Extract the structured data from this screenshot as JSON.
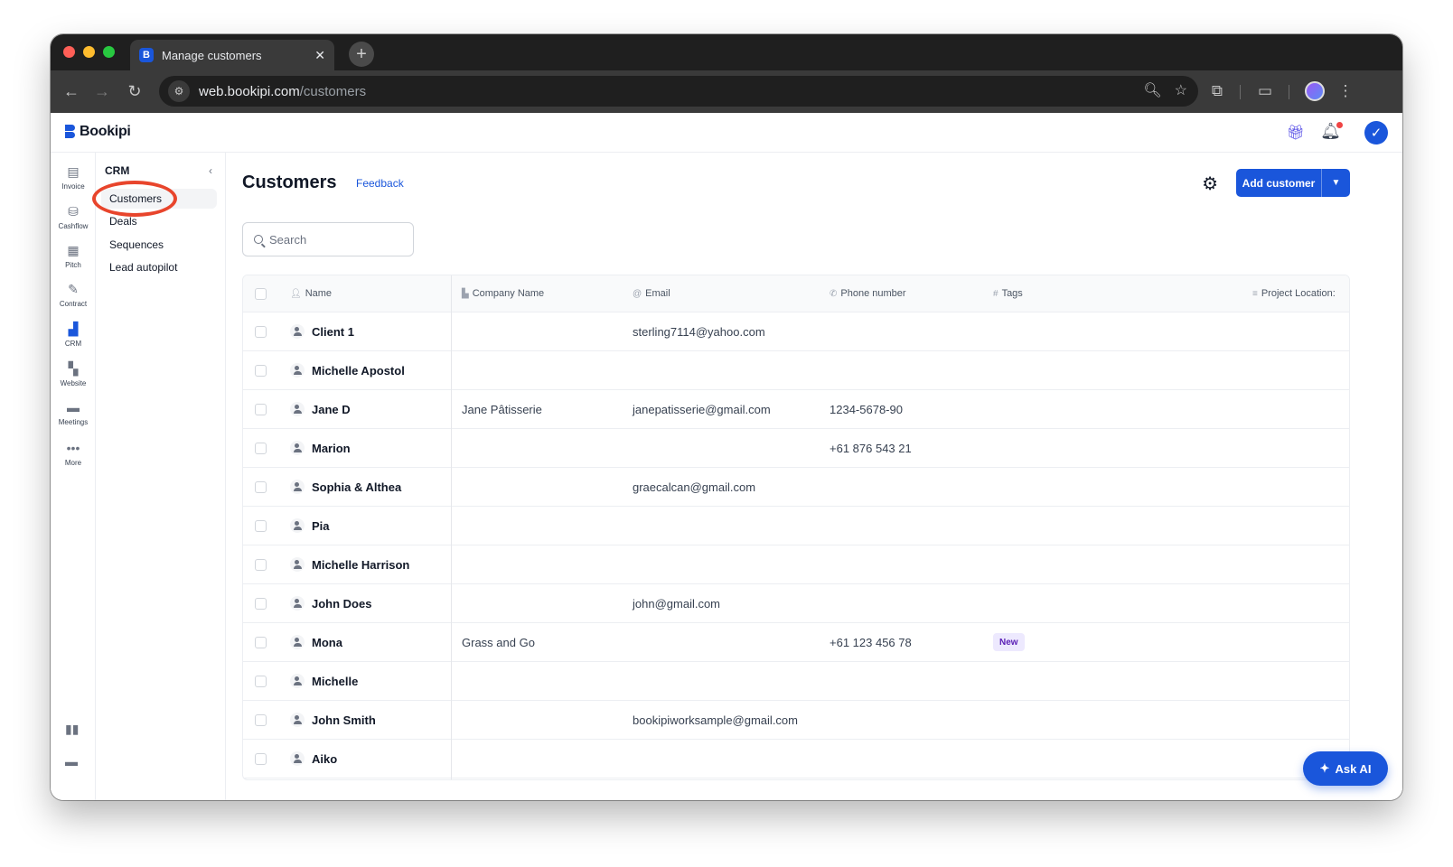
{
  "browser": {
    "tab_title": "Manage customers",
    "favicon_letter": "B",
    "url_host": "web.bookipi.com",
    "url_path": "/customers"
  },
  "app": {
    "brand": "Bookipi",
    "accent_color": "#1a56db"
  },
  "rail": {
    "items": [
      {
        "label": "Invoice",
        "icon": "invoice-icon"
      },
      {
        "label": "Cashflow",
        "icon": "cashflow-icon"
      },
      {
        "label": "Pitch",
        "icon": "pitch-icon"
      },
      {
        "label": "Contract",
        "icon": "contract-icon"
      },
      {
        "label": "CRM",
        "icon": "crm-icon",
        "active": true
      },
      {
        "label": "Website",
        "icon": "website-icon"
      },
      {
        "label": "Meetings",
        "icon": "meetings-icon"
      },
      {
        "label": "More",
        "icon": "more-icon"
      }
    ]
  },
  "subnav": {
    "title": "CRM",
    "items": [
      {
        "label": "Customers",
        "active": true
      },
      {
        "label": "Deals"
      },
      {
        "label": "Sequences"
      },
      {
        "label": "Lead autopilot"
      }
    ]
  },
  "main": {
    "title": "Customers",
    "feedback": "Feedback",
    "add_button": "Add customer",
    "search_placeholder": "Search"
  },
  "table": {
    "columns": {
      "name": "Name",
      "company": "Company Name",
      "email": "Email",
      "phone": "Phone number",
      "tags": "Tags",
      "location": "Project Location:"
    },
    "rows": [
      {
        "name": "Client 1",
        "company": "",
        "email": "sterling7114@yahoo.com",
        "phone": "",
        "tag": ""
      },
      {
        "name": "Michelle Apostol",
        "company": "",
        "email": "",
        "phone": "",
        "tag": ""
      },
      {
        "name": "Jane D",
        "company": "Jane Pâtisserie",
        "email": "janepatisserie@gmail.com",
        "phone": "1234-5678-90",
        "tag": ""
      },
      {
        "name": "Marion",
        "company": "",
        "email": "",
        "phone": "+61 876 543 21",
        "tag": ""
      },
      {
        "name": "Sophia & Althea",
        "company": "",
        "email": "graecalcan@gmail.com",
        "phone": "",
        "tag": ""
      },
      {
        "name": "Pia",
        "company": "",
        "email": "",
        "phone": "",
        "tag": ""
      },
      {
        "name": "Michelle Harrison",
        "company": "",
        "email": "",
        "phone": "",
        "tag": ""
      },
      {
        "name": "John Does",
        "company": "",
        "email": "john@gmail.com",
        "phone": "",
        "tag": ""
      },
      {
        "name": "Mona",
        "company": "Grass and Go",
        "email": "",
        "phone": "+61 123 456 78",
        "tag": "New"
      },
      {
        "name": "Michelle",
        "company": "",
        "email": "",
        "phone": "",
        "tag": ""
      },
      {
        "name": "John Smith",
        "company": "",
        "email": "bookipiworksample@gmail.com",
        "phone": "",
        "tag": ""
      },
      {
        "name": "Aiko",
        "company": "",
        "email": "",
        "phone": "",
        "tag": ""
      }
    ]
  },
  "ask_ai": "Ask AI"
}
